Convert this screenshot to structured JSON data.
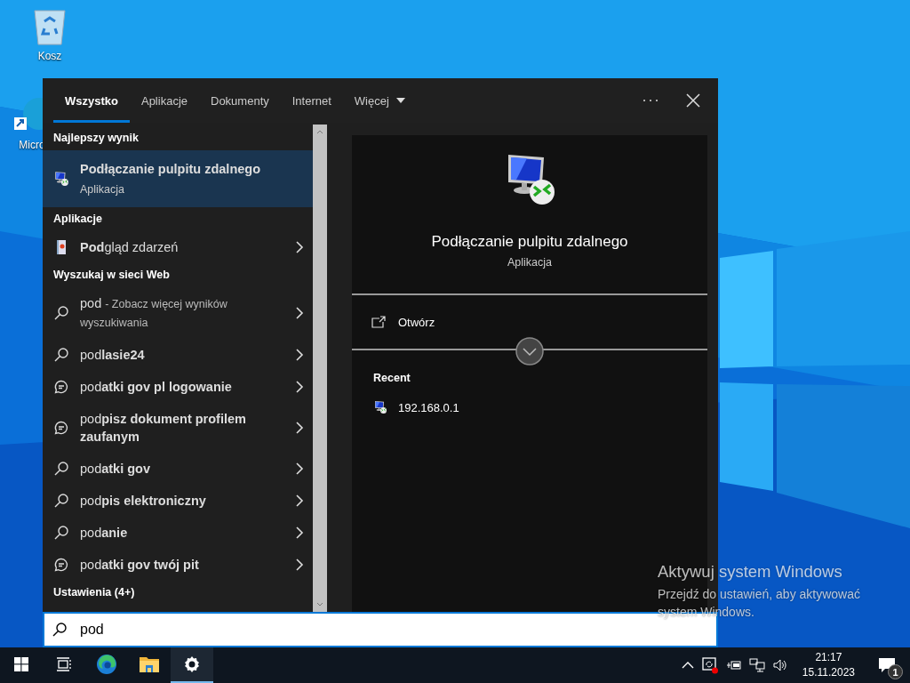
{
  "desktop_icons": [
    {
      "label": "Kosz",
      "kind": "recycle-bin"
    },
    {
      "label": "Micro",
      "kind": "edge-shortcut"
    }
  ],
  "search_panel": {
    "tabs": [
      {
        "label": "Wszystko",
        "selected": true,
        "kind": "tab"
      },
      {
        "label": "Aplikacje",
        "selected": false,
        "kind": "tab"
      },
      {
        "label": "Dokumenty",
        "selected": false,
        "kind": "tab"
      },
      {
        "label": "Internet",
        "selected": false,
        "kind": "tab"
      },
      {
        "label": "Więcej",
        "selected": false,
        "kind": "dropdown"
      }
    ],
    "sections": [
      {
        "heading": "Najlepszy wynik",
        "items": [
          {
            "kind": "best",
            "title": "Podłączanie pulpitu zdalnego",
            "subtitle": "Aplikacja",
            "selected": true
          }
        ]
      },
      {
        "heading": "Aplikacje",
        "items": [
          {
            "kind": "app",
            "title": "**Pod**gląd zdarzeń",
            "selected": false
          }
        ]
      },
      {
        "heading": "Wyszukaj w sieci Web",
        "items": [
          {
            "kind": "search",
            "title": "pod",
            "note": "- Zobacz więcej wyników wyszukiwania",
            "selected": false
          },
          {
            "kind": "search",
            "title": "pod**lasie24**",
            "selected": false
          },
          {
            "kind": "trending",
            "title": "pod**atki gov pl logowanie**",
            "selected": false
          },
          {
            "kind": "trending",
            "title": "pod**pisz dokument profilem zaufanym**",
            "selected": false
          },
          {
            "kind": "search",
            "title": "pod**atki gov**",
            "selected": false
          },
          {
            "kind": "search",
            "title": "pod**pis elektroniczny**",
            "selected": false
          },
          {
            "kind": "search",
            "title": "pod**anie**",
            "selected": false
          },
          {
            "kind": "trending",
            "title": "pod**atki gov twój pit**",
            "selected": false
          }
        ]
      },
      {
        "heading": "Ustawienia (4+)"
      }
    ],
    "search_field": {
      "value": "pod"
    },
    "preview": {
      "title": "Podłączanie pulpitu zdalnego",
      "subtitle": "Aplikacja",
      "actions": [
        {
          "label": "Otwórz"
        }
      ],
      "recent_heading": "Recent",
      "recent": [
        {
          "label": "192.168.0.1"
        }
      ]
    }
  },
  "activation_notice": {
    "title": "Aktywuj system Windows",
    "text": "Przejdź do ustawień, aby aktywować system Windows."
  },
  "taskbar": {
    "apps": [
      {
        "kind": "start",
        "active": false
      },
      {
        "kind": "task-view",
        "active": false
      },
      {
        "kind": "edge",
        "active": false
      },
      {
        "kind": "explorer",
        "active": false
      },
      {
        "kind": "settings",
        "active": true
      }
    ],
    "clock": {
      "time": "21:17",
      "date": "15.11.2023"
    },
    "notifications": {
      "count": "1"
    }
  }
}
